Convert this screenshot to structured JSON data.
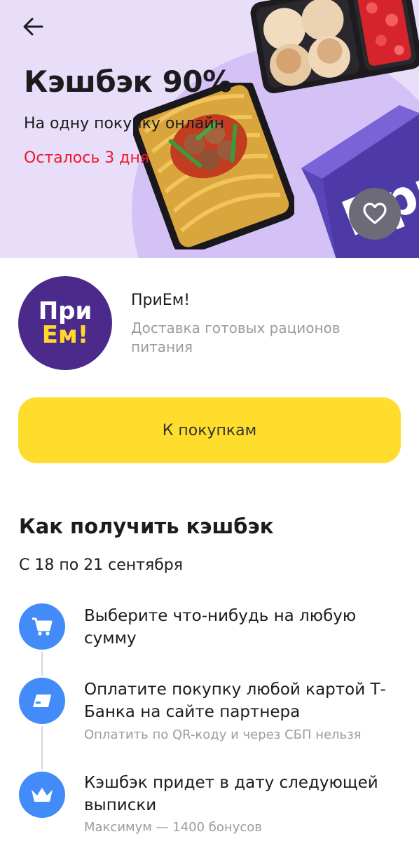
{
  "hero": {
    "title": "Кэшбэк 90%",
    "subtitle": "На одну покупку онлайн",
    "deadline": "Осталось 3 дня",
    "box_text": "При"
  },
  "partner": {
    "logo_line1": "При",
    "logo_line2": "Ем!",
    "name": "ПриЕм!",
    "description": "Доставка готовых рационов питания"
  },
  "cta": {
    "label": "К покупкам"
  },
  "how": {
    "title": "Как получить кэшбэк",
    "dates": "С 18 по 21 сентября",
    "steps": [
      {
        "icon": "cart-icon",
        "text": "Выберите что-нибудь на любую сумму",
        "note": ""
      },
      {
        "icon": "card-icon",
        "text": "Оплатите покупку любой картой Т-Банка на сайте партнера",
        "note": "Оплатить по QR-коду и через СБП нельзя"
      },
      {
        "icon": "crown-icon",
        "text": "Кэшбэк придет в дату следующей выписки",
        "note": "Максимум — 1400 бонусов"
      }
    ]
  },
  "colors": {
    "hero_bg": "#e8defa",
    "accent_yellow": "#ffdd2d",
    "step_blue": "#428bf9",
    "deadline_red": "#f0162b",
    "brand_purple": "#4b2a8c"
  }
}
